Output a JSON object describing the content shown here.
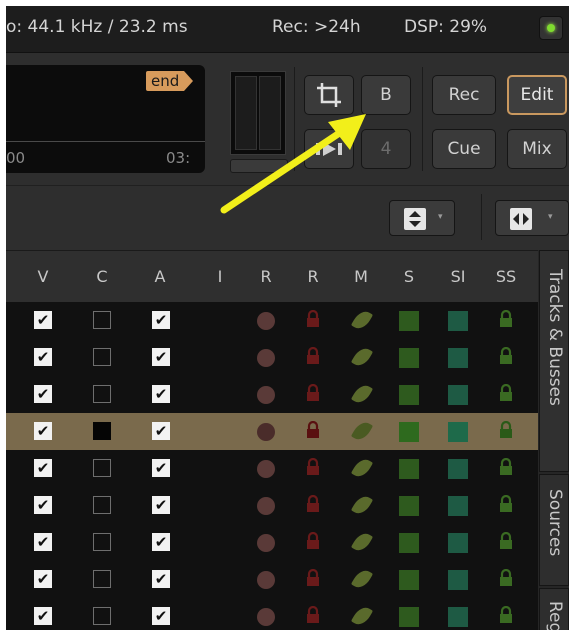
{
  "status_bar": {
    "sample_rate": "o: 44.1 kHz / 23.2 ms",
    "record_time": "Rec: >24h",
    "dsp_load": "DSP: 29%"
  },
  "mini_timeline": {
    "end_marker": "end",
    "time_left": "00",
    "time_right": "03:"
  },
  "toolbar_buttons": {
    "crop_icon": "crop-icon",
    "b_label": "B",
    "four_label": "4",
    "rec_label": "Rec",
    "edit_label": "Edit",
    "cue_label": "Cue",
    "mix_label": "Mix"
  },
  "column_headers": [
    "V",
    "C",
    "A",
    "I",
    "R",
    "R",
    "M",
    "S",
    "SI",
    "SS"
  ],
  "rows": [
    {
      "v": true,
      "c": false,
      "a": true,
      "selected": false
    },
    {
      "v": true,
      "c": false,
      "a": true,
      "selected": false
    },
    {
      "v": true,
      "c": false,
      "a": true,
      "selected": false
    },
    {
      "v": true,
      "c": "filled",
      "a": true,
      "selected": true
    },
    {
      "v": true,
      "c": false,
      "a": true,
      "selected": false
    },
    {
      "v": true,
      "c": false,
      "a": true,
      "selected": false
    },
    {
      "v": true,
      "c": false,
      "a": true,
      "selected": false
    },
    {
      "v": true,
      "c": false,
      "a": true,
      "selected": false
    },
    {
      "v": true,
      "c": false,
      "a": true,
      "selected": false
    }
  ],
  "side_tabs": {
    "tracks_busses": "Tracks & Busses",
    "sources": "Sources",
    "regions": "Reg"
  },
  "colors": {
    "accent_edit": "#c9985f",
    "end_marker": "#d79b5c",
    "selected_row": "#7a6a4c",
    "arrow": "#f2ef1a",
    "dsp_led": "#7fdc2f"
  }
}
